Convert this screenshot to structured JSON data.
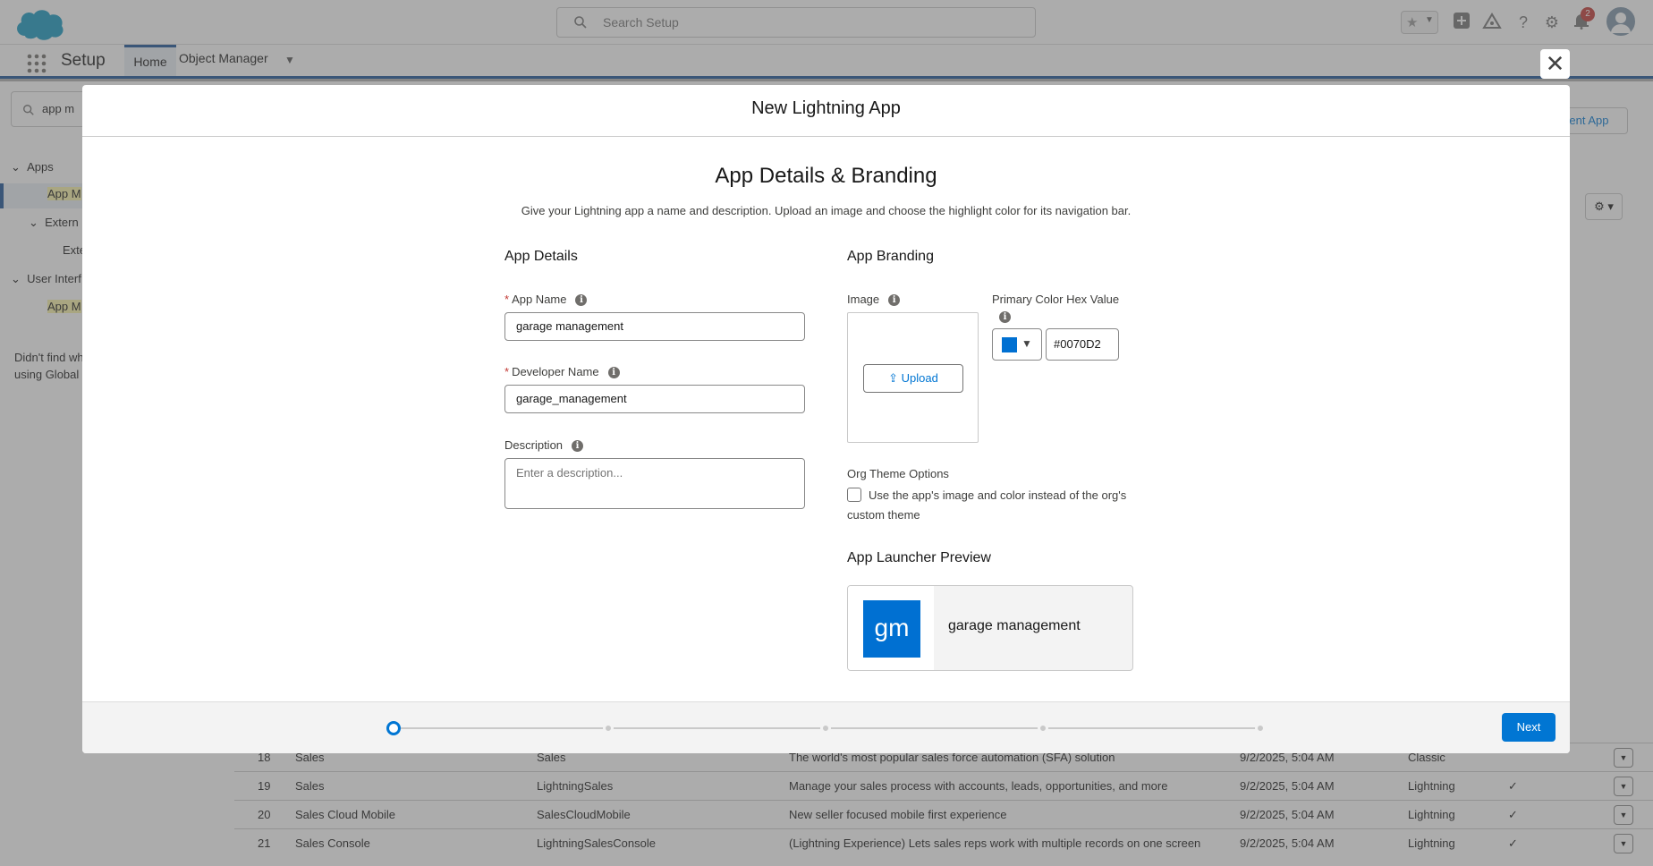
{
  "header": {
    "search_placeholder": "Search Setup",
    "notification_count": "2"
  },
  "nav": {
    "app_name": "Setup",
    "tabs": [
      {
        "label": "Home"
      },
      {
        "label": "Object Manager"
      }
    ]
  },
  "sidebar": {
    "search_value": "app m",
    "tree": [
      {
        "label": "Apps"
      },
      {
        "label": "App M"
      },
      {
        "label": "Extern"
      },
      {
        "label": "Exte"
      },
      {
        "label": "User Interf"
      },
      {
        "label": "App M"
      }
    ],
    "help_text_1": "Didn't find wh",
    "help_text_2": "using Global"
  },
  "background": {
    "new_button_label": "ient App",
    "rows": [
      {
        "num": "18",
        "label": "Sales",
        "dev_name": "Sales",
        "description": "The world's most popular sales force automation (SFA) solution",
        "date": "9/2/2025, 5:04 AM",
        "ui": "Classic",
        "check": ""
      },
      {
        "num": "19",
        "label": "Sales",
        "dev_name": "LightningSales",
        "description": "Manage your sales process with accounts, leads, opportunities, and more",
        "date": "9/2/2025, 5:04 AM",
        "ui": "Lightning",
        "check": "✓"
      },
      {
        "num": "20",
        "label": "Sales Cloud Mobile",
        "dev_name": "SalesCloudMobile",
        "description": "New seller focused mobile first experience",
        "date": "9/2/2025, 5:04 AM",
        "ui": "Lightning",
        "check": "✓"
      },
      {
        "num": "21",
        "label": "Sales Console",
        "dev_name": "LightningSalesConsole",
        "description": "(Lightning Experience) Lets sales reps work with multiple records on one screen",
        "date": "9/2/2025, 5:04 AM",
        "ui": "Lightning",
        "check": "✓"
      }
    ]
  },
  "modal": {
    "title": "New Lightning App",
    "heading": "App Details & Branding",
    "subtitle": "Give your Lightning app a name and description. Upload an image and choose the highlight color for its navigation bar.",
    "details": {
      "section_title": "App Details",
      "app_name_label": "App Name",
      "app_name_value": "garage management",
      "dev_name_label": "Developer Name",
      "dev_name_value": "garage_management",
      "description_label": "Description",
      "description_placeholder": "Enter a description..."
    },
    "branding": {
      "section_title": "App Branding",
      "image_label": "Image",
      "upload_label": "Upload",
      "color_label": "Primary Color Hex Value",
      "color_value": "#0070D2",
      "org_theme_label": "Org Theme Options",
      "checkbox_label": "Use the app's image and color instead of the org's custom theme",
      "checkbox_checked": false,
      "preview_title": "App Launcher Preview",
      "preview_initials": "gm",
      "preview_name": "garage management"
    },
    "footer": {
      "steps": 5,
      "current_step": 1,
      "next_label": "Next"
    }
  },
  "colors": {
    "brand_blue": "#0176d3",
    "app_color": "#0070d2",
    "required": "#c23934"
  }
}
